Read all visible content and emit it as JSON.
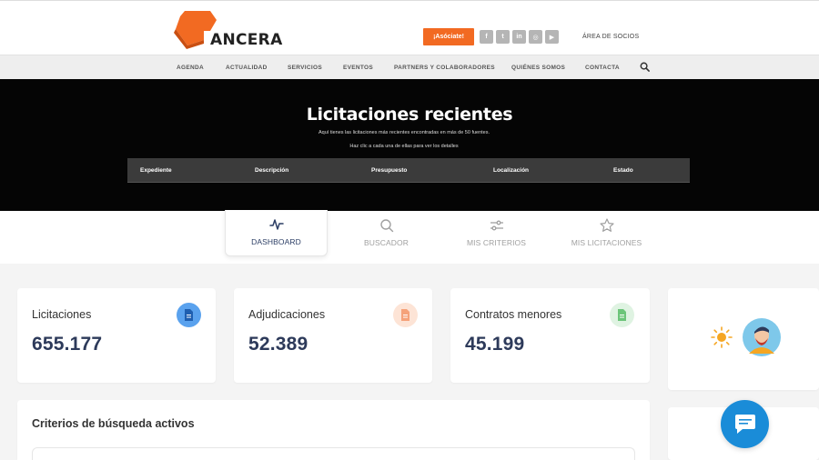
{
  "header": {
    "logo_text": "ANCERA",
    "cta_label": "¡Asóciate!",
    "socials": [
      {
        "name": "facebook",
        "glyph": "f"
      },
      {
        "name": "twitter",
        "glyph": "t"
      },
      {
        "name": "linkedin",
        "glyph": "in"
      },
      {
        "name": "instagram",
        "glyph": "◎"
      },
      {
        "name": "youtube",
        "glyph": "▶"
      }
    ],
    "area_socios": "ÁREA DE SOCIOS"
  },
  "nav": {
    "items": [
      "AGENDA",
      "ACTUALIDAD",
      "SERVICIOS",
      "EVENTOS",
      "PARTNERS Y COLABORADORES",
      "QUIÉNES SOMOS",
      "CONTACTA"
    ]
  },
  "hero": {
    "title": "Licitaciones recientes",
    "subtitle1": "Aquí tienes las licitaciones más recientes encontradas en más de 50 fuentes.",
    "subtitle2": "Haz clic a cada una de ellas para ver los detalles",
    "columns": [
      "Expediente",
      "Descripción",
      "Presupuesto",
      "Localización",
      "Estado"
    ]
  },
  "tabs": [
    {
      "label": "DASHBOARD",
      "icon": "activity-icon",
      "active": true
    },
    {
      "label": "BUSCADOR",
      "icon": "search-icon",
      "active": false
    },
    {
      "label": "MIS CRITERIOS",
      "icon": "sliders-icon",
      "active": false
    },
    {
      "label": "MIS LICITACIONES",
      "icon": "star-icon",
      "active": false
    }
  ],
  "stats": [
    {
      "title": "Licitaciones",
      "value": "655.177",
      "icon": "document-icon",
      "color": "#3a8ee6",
      "bg": "#5aa2ee"
    },
    {
      "title": "Adjudicaciones",
      "value": "52.389",
      "icon": "document-icon",
      "color": "#f5a27a",
      "bg": "#fde4d6"
    },
    {
      "title": "Contratos menores",
      "value": "45.199",
      "icon": "document-icon",
      "color": "#6cc57a",
      "bg": "#dff3e2"
    }
  ],
  "criterios": {
    "title": "Criterios de búsqueda activos"
  },
  "colors": {
    "accent_orange": "#f26a22",
    "hero_bg": "#050505",
    "nav_bg": "#eeeeee",
    "dashboard_bg": "#f4f4f4",
    "chat_blue": "#1a8cd8",
    "value_navy": "#2d3a5a"
  }
}
